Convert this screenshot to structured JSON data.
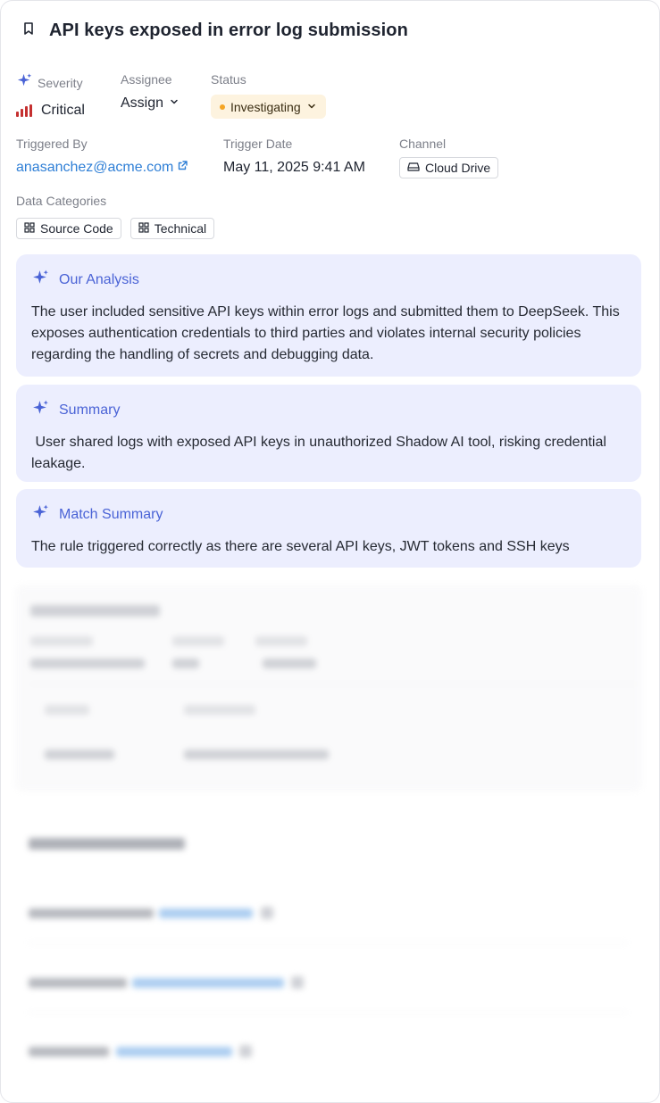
{
  "header": {
    "title": "API keys exposed in error log submission"
  },
  "severity": {
    "label": "Severity",
    "value": "Critical",
    "color": "#c53030"
  },
  "assignee": {
    "label": "Assignee",
    "value": "Assign"
  },
  "status": {
    "label": "Status",
    "value": "Investigating",
    "color": "#f5a524"
  },
  "triggered_by": {
    "label": "Triggered By",
    "value": "anasanchez@acme.com"
  },
  "trigger_date": {
    "label": "Trigger Date",
    "value": "May 11, 2025 9:41 AM"
  },
  "channel": {
    "label": "Channel",
    "value": "Cloud Drive"
  },
  "data_categories": {
    "label": "Data Categories",
    "items": [
      "Source Code",
      "Technical"
    ]
  },
  "analysis": {
    "title": "Our Analysis",
    "body": "The user included sensitive API keys within error logs and submitted them to DeepSeek. This exposes authentication credentials to third parties and violates internal security policies regarding the handling of secrets and debugging data."
  },
  "summary": {
    "title": "Summary",
    "body": " User shared logs with exposed API keys in unauthorized Shadow AI tool, risking credential leakage."
  },
  "match_summary": {
    "title": "Match Summary",
    "body": "The rule triggered correctly as there are several API keys, JWT tokens and SSH keys"
  },
  "colors": {
    "accent": "#4a63d6",
    "panel_bg": "#eceefe",
    "link": "#2f7fd6"
  }
}
